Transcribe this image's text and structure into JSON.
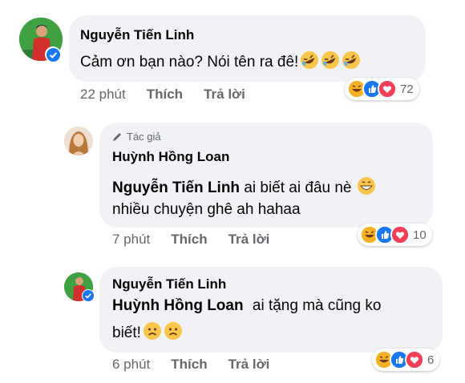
{
  "comments": [
    {
      "author": "Nguyễn Tiến Linh",
      "text": "Cảm ơn bạn nào? Nói tên ra đê!",
      "time": "22 phút",
      "like_label": "Thích",
      "reply_label": "Trả lời",
      "reaction_icons": [
        "haha-icon",
        "like-icon",
        "love-icon"
      ],
      "reaction_count": "72",
      "inline_emojis": [
        "rofl-emoji",
        "rofl-emoji",
        "rofl-emoji"
      ]
    },
    {
      "author_badge": "Tác giả",
      "author": "Huỳnh Hồng Loan",
      "mention": "Nguyễn Tiến Linh",
      "text_line1": "ai biết ai đâu nè",
      "text_line2": "nhiều chuyện ghê ah hahaa",
      "time": "7 phút",
      "like_label": "Thích",
      "reply_label": "Trả lời",
      "reaction_icons": [
        "haha-icon",
        "like-icon",
        "love-icon"
      ],
      "reaction_count": "10",
      "inline_emojis": [
        "grin-emoji"
      ]
    },
    {
      "author": "Nguyễn Tiến Linh",
      "mention": "Huỳnh Hồng Loan",
      "text_line1": "ai tặng mà cũng ko",
      "text_line2": "biết!",
      "time": "6 phút",
      "like_label": "Thích",
      "reply_label": "Trả lời",
      "reaction_icons": [
        "haha-icon",
        "like-icon",
        "love-icon"
      ],
      "reaction_count": "6",
      "inline_emojis": [
        "frown-emoji",
        "frown-emoji"
      ]
    }
  ],
  "colors": {
    "bubble": "#f0f2f5",
    "secondary_text": "#65676b",
    "like_blue": "#1877f2",
    "love_red": "#f33e58",
    "haha_yellow": "#f7b125",
    "avatar_green": "#3a9a3e"
  }
}
